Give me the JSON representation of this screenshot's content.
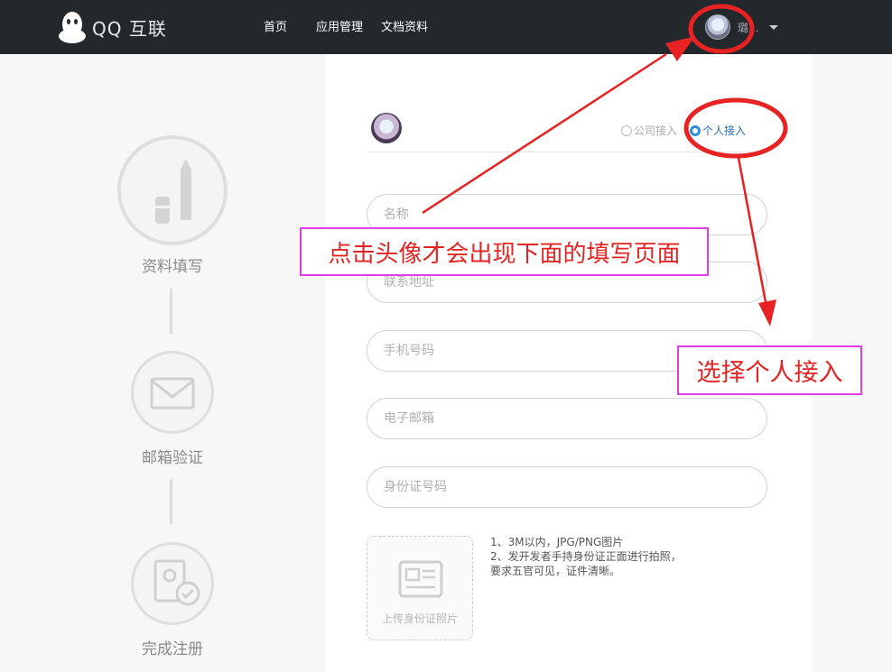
{
  "header": {
    "brand": "QQ 互联",
    "nav": [
      "首页",
      "应用管理",
      "文档资料"
    ],
    "user_name": "璐..."
  },
  "steps": [
    {
      "label": "资料填写",
      "icon": "pen-icon"
    },
    {
      "label": "邮箱验证",
      "icon": "envelope-icon"
    },
    {
      "label": "完成注册",
      "icon": "id-check-icon"
    }
  ],
  "form": {
    "account_types": {
      "company": "公司接入",
      "personal": "个人接入",
      "selected": "personal"
    },
    "fields": [
      {
        "key": "name",
        "placeholder": "名称"
      },
      {
        "key": "address",
        "placeholder": "联系地址"
      },
      {
        "key": "phone",
        "placeholder": "手机号码"
      },
      {
        "key": "email",
        "placeholder": "电子邮箱"
      },
      {
        "key": "idcard",
        "placeholder": "身份证号码"
      }
    ],
    "upload_label": "上传身份证照片",
    "notes": [
      "1、3M以内，JPG/PNG图片",
      "2、发开发者手持身份证正面进行拍照，",
      "要求五官可见，证件清晰。"
    ]
  },
  "annotations": {
    "avatar_note": "点击头像才会出现下面的填写页面",
    "personal_note": "选择个人接入",
    "colors": {
      "arrow": "#e62222",
      "box_border": "#e23de2",
      "text": "#e32424"
    }
  }
}
